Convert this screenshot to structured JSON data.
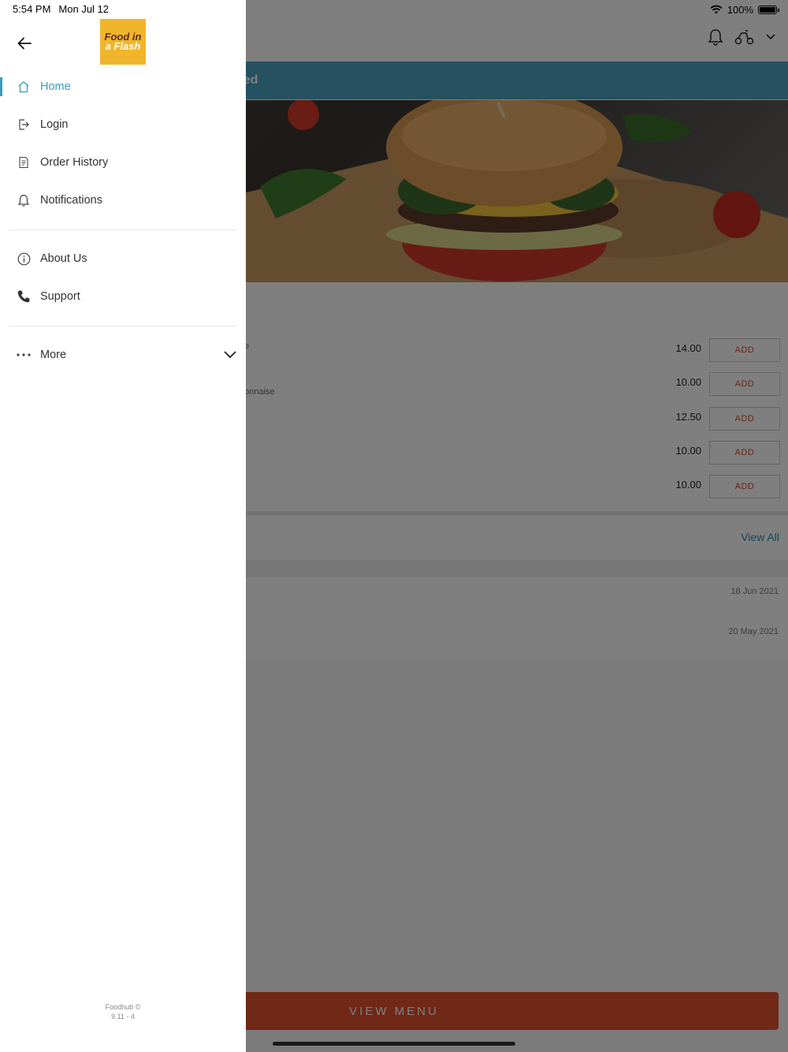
{
  "status_bar": {
    "time": "5:54 PM",
    "date": "Mon Jul 12",
    "battery": "100%"
  },
  "drawer": {
    "logo": {
      "line1": "Food in",
      "line2": "a Flash"
    },
    "nav_items": [
      {
        "label": "Home",
        "icon": "home-icon",
        "active": true
      },
      {
        "label": "Login",
        "icon": "login-icon",
        "active": false
      },
      {
        "label": "Order History",
        "icon": "receipt-icon",
        "active": false
      },
      {
        "label": "Notifications",
        "icon": "bell-icon",
        "active": false
      }
    ],
    "info_items": [
      {
        "label": "About Us",
        "icon": "info-icon"
      },
      {
        "label": "Support",
        "icon": "phone-icon"
      }
    ],
    "more": {
      "label": "More",
      "icon": "dots-icon"
    },
    "footer": {
      "line1": "Foodhub ©",
      "line2": "9.11 - 4"
    }
  },
  "background": {
    "banner_text": "osed",
    "menu_items": [
      {
        "desc": "e",
        "price": "14.00",
        "button": "ADD"
      },
      {
        "desc": "onnaise",
        "price": "10.00",
        "button": "ADD"
      },
      {
        "desc": "",
        "price": "12.50",
        "button": "ADD"
      },
      {
        "desc": "",
        "price": "10.00",
        "button": "ADD"
      },
      {
        "desc": "",
        "price": "10.00",
        "button": "ADD"
      }
    ],
    "view_all": "View All",
    "orders": [
      {
        "date": "18 Jun 2021"
      },
      {
        "date": "20 May 2021"
      }
    ],
    "view_menu": "VIEW MENU"
  },
  "colors": {
    "accent": "#3a9bbd",
    "banner": "#4aa3c0",
    "button": "#e0512f",
    "logo_bg": "#f0b52b"
  }
}
